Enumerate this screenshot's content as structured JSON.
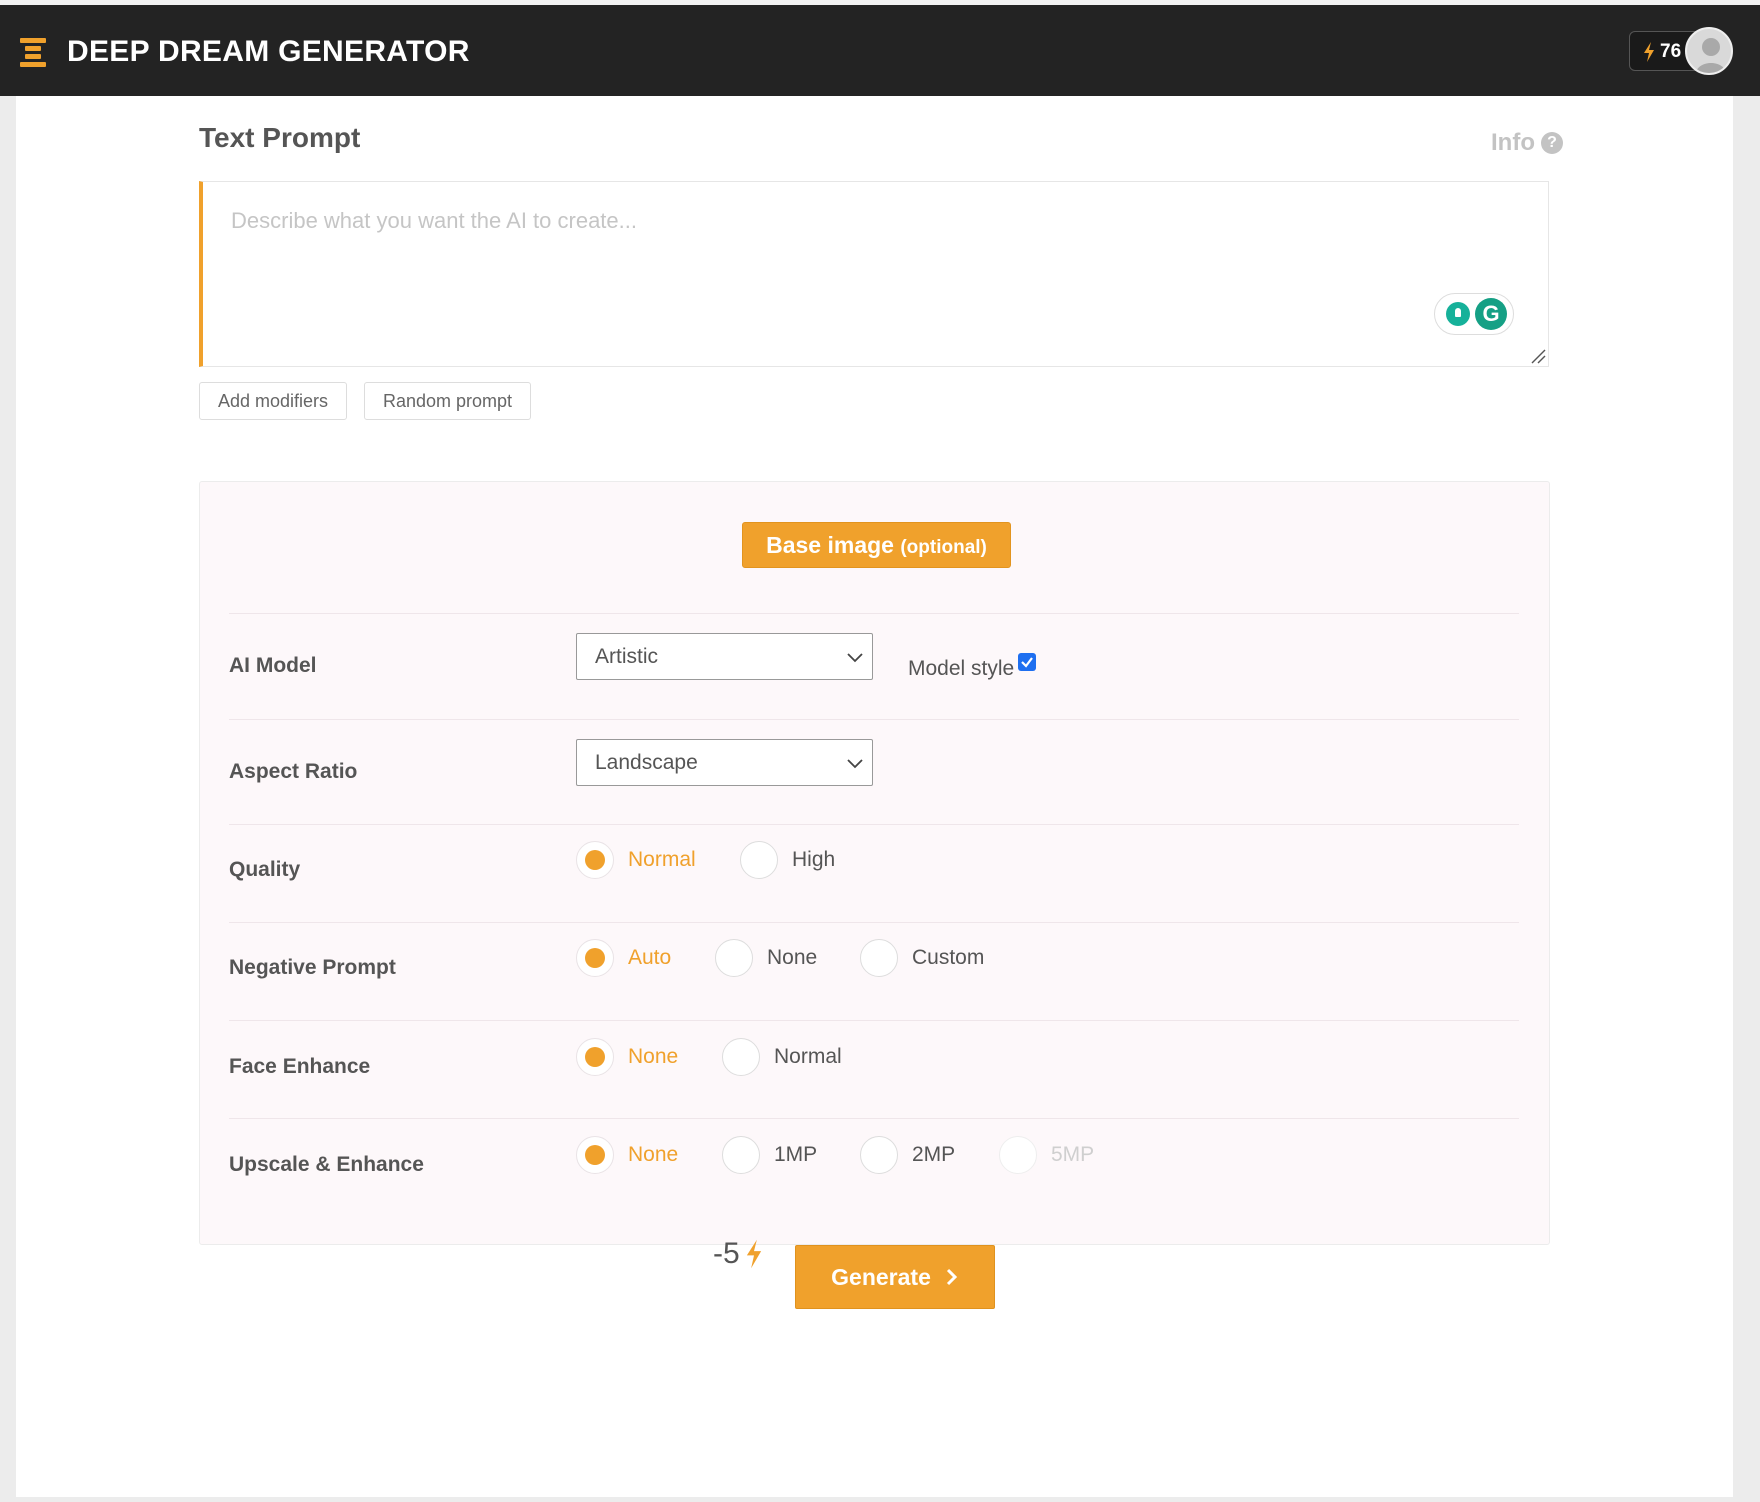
{
  "header": {
    "brand": "DEEP DREAM GENERATOR",
    "energy_count": "76",
    "accent_color": "#f0a12c"
  },
  "prompt": {
    "title": "Text Prompt",
    "info_label": "Info",
    "info_icon": "question-circle-icon",
    "placeholder": "Describe what you want the AI to create...",
    "value": "",
    "add_modifiers_label": "Add modifiers",
    "random_prompt_label": "Random prompt"
  },
  "settings": {
    "base_image_label": "Base image",
    "base_image_optional": "(optional)",
    "ai_model": {
      "label": "AI Model",
      "selected": "Artistic",
      "model_style_label": "Model style",
      "model_style_checked": true
    },
    "aspect_ratio": {
      "label": "Aspect Ratio",
      "selected": "Landscape"
    },
    "quality": {
      "label": "Quality",
      "options": [
        "Normal",
        "High"
      ],
      "selected": "Normal"
    },
    "negative_prompt": {
      "label": "Negative Prompt",
      "options": [
        "Auto",
        "None",
        "Custom"
      ],
      "selected": "Auto"
    },
    "face_enhance": {
      "label": "Face Enhance",
      "options": [
        "None",
        "Normal"
      ],
      "selected": "None"
    },
    "upscale": {
      "label": "Upscale & Enhance",
      "options": [
        "None",
        "1MP",
        "2MP",
        "5MP"
      ],
      "selected": "None",
      "disabled": [
        "5MP"
      ]
    }
  },
  "footer": {
    "cost": "-5",
    "generate_label": "Generate"
  }
}
